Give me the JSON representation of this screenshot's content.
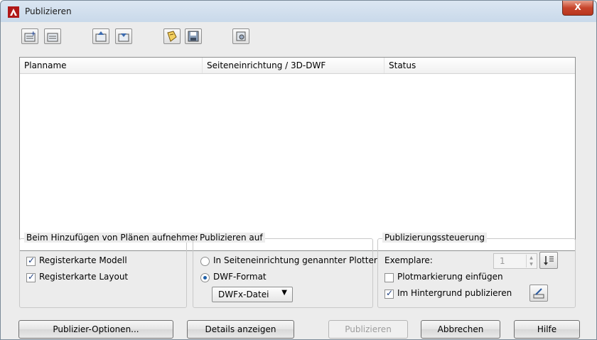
{
  "window": {
    "title": "Publizieren",
    "close_label": "X"
  },
  "toolbar": {
    "buttons": [
      {
        "name": "add-sheets-icon"
      },
      {
        "name": "remove-sheets-icon"
      },
      {
        "name": "move-sheet-up-icon"
      },
      {
        "name": "move-sheet-down-icon"
      },
      {
        "name": "preview-icon"
      },
      {
        "name": "save-list-icon"
      },
      {
        "name": "plot-stamp-settings-icon"
      }
    ]
  },
  "sheet_list": {
    "columns": [
      "Planname",
      "Seiteneinrichtung / 3D-DWF",
      "Status"
    ],
    "rows": []
  },
  "add_sheets_group": {
    "title": "Beim Hinzufügen von Plänen aufnehmen",
    "model_tab": {
      "label": "Registerkarte Modell",
      "checked": true
    },
    "layout_tab": {
      "label": "Registerkarte Layout",
      "checked": true
    }
  },
  "publish_to_group": {
    "title": "Publizieren auf",
    "option_plotter": {
      "label": "In Seiteneinrichtung genannter Plotter",
      "selected": false
    },
    "option_dwf": {
      "label": "DWF-Format",
      "selected": true
    },
    "format_select": {
      "value": "DWFx-Datei"
    }
  },
  "publish_control_group": {
    "title": "Publizierungssteuerung",
    "copies_label": "Exemplare:",
    "copies_value": "1",
    "plot_stamp": {
      "label": "Plotmarkierung einfügen",
      "checked": false
    },
    "background": {
      "label": "Im Hintergrund publizieren",
      "checked": true
    }
  },
  "buttons": {
    "options": "Publizier-Optionen...",
    "details": "Details anzeigen",
    "publish": "Publizieren",
    "cancel": "Abbrechen",
    "help": "Hilfe"
  },
  "colors": {
    "accent": "#1e5fa8",
    "close_red": "#c7452c"
  }
}
